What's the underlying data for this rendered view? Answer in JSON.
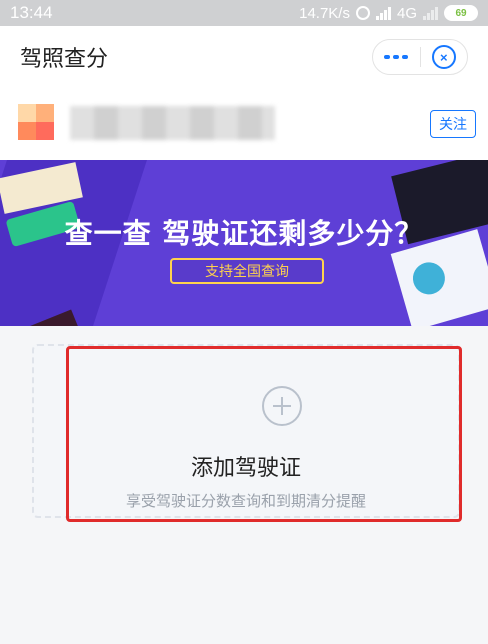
{
  "status_bar": {
    "time": "13:44",
    "net_speed": "14.7K/s",
    "network": "4G",
    "battery": "69"
  },
  "header": {
    "title": "驾照查分",
    "more_icon": "more-icon",
    "close_icon": "close-circle-icon",
    "close_glyph": "×"
  },
  "service": {
    "follow_label": "关注"
  },
  "banner": {
    "headline": "查一查 驾驶证还剩多少分？",
    "pill": "支持全国查询"
  },
  "add_card": {
    "icon": "plus-circle-icon",
    "title": "添加驾驶证",
    "subtitle": "享受驾驶证分数查询和到期清分提醒",
    "highlight_color": "#e02b2b"
  },
  "colors": {
    "accent": "#1677ff",
    "banner": "#5e3fd6",
    "pill": "#ffd24d"
  }
}
